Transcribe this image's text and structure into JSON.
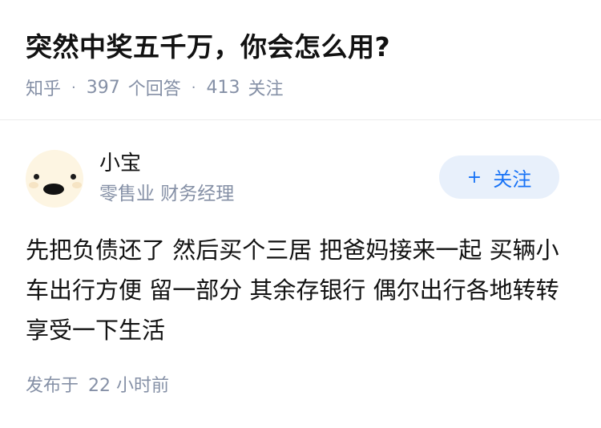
{
  "question": {
    "title": "突然中奖五千万，你会怎么用?",
    "source": "知乎",
    "answer_count": "397",
    "answer_label": "个回答",
    "follow_count": "413",
    "follow_label": "关注",
    "separator": "·"
  },
  "answer": {
    "author": {
      "name": "小宝",
      "bio": "零售业 财务经理",
      "avatar_icon": "smiling-face-avatar"
    },
    "follow_button": {
      "icon": "+",
      "label": "关注",
      "background": "#e8f0fb",
      "color": "#1772f6"
    },
    "content": "先把负债还了 然后买个三居 把爸妈接来一起 买辆小车出行方便 留一部分 其余存银行 偶尔出行各地转转享受一下生活",
    "posted_prefix": "发布于",
    "posted_time": "22 小时前"
  },
  "colors": {
    "text": "#121212",
    "meta": "#8590a6",
    "divider": "#ececec"
  }
}
